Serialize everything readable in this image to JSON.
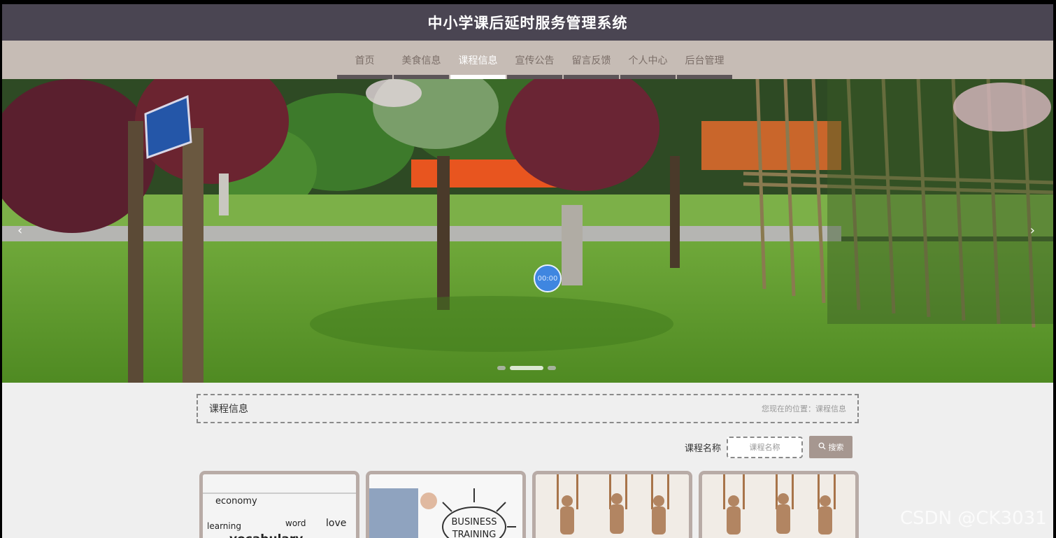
{
  "header": {
    "title": "中小学课后延时服务管理系统"
  },
  "nav": {
    "items": [
      {
        "label": "首页"
      },
      {
        "label": "美食信息"
      },
      {
        "label": "课程信息",
        "active": true
      },
      {
        "label": "宣传公告"
      },
      {
        "label": "留言反馈"
      },
      {
        "label": "个人中心"
      },
      {
        "label": "后台管理"
      }
    ]
  },
  "banner": {
    "prev_icon": "chevron-left-icon",
    "next_icon": "chevron-right-icon",
    "video_time": "00:00",
    "active_slide": 2,
    "slide_count": 3
  },
  "breadcrumb": {
    "title": "课程信息",
    "path": "您现在的位置：课程信息"
  },
  "search": {
    "label": "课程名称",
    "placeholder": "课程名称",
    "button": "搜索",
    "button_icon": "search-icon"
  },
  "courses": [
    {
      "image_text": [
        "economy",
        "learning",
        "love",
        "word",
        "vocabulary"
      ]
    },
    {
      "image_text": [
        "BUSINESS",
        "TRAINING"
      ]
    },
    {
      "image_text": []
    },
    {
      "image_text": []
    }
  ],
  "watermark": "CSDN @CK3031",
  "colors": {
    "topbar": "#4a4552",
    "navbar": "#c6bcb5",
    "search_button": "#a69790",
    "active_nav": "#ffffff"
  }
}
